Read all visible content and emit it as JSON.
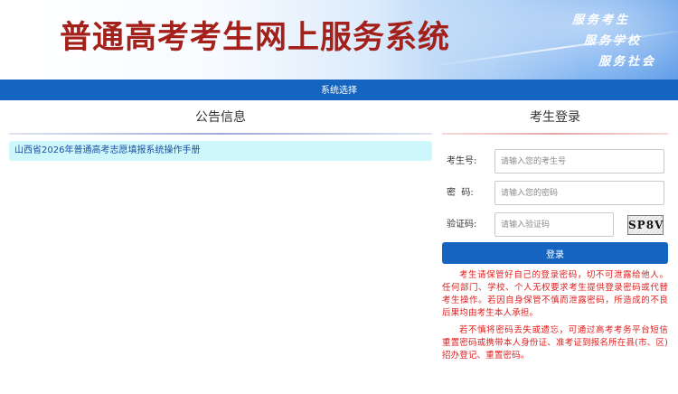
{
  "header": {
    "title": "普通高考考生网上服务系统",
    "slogans": [
      "服务考生",
      "服务学校",
      "服务社会"
    ]
  },
  "nav": {
    "items": [
      {
        "label": "系统选择"
      }
    ]
  },
  "notice": {
    "title": "公告信息",
    "items": [
      {
        "text": "山西省2026年普通高考志愿填报系统操作手册"
      }
    ]
  },
  "login": {
    "title": "考生登录",
    "fields": {
      "exam_no": {
        "label": "考生号:",
        "placeholder": "请输入您的考生号",
        "value": ""
      },
      "password": {
        "label": "密  码:",
        "placeholder": "请输入您的密码",
        "value": ""
      },
      "captcha": {
        "label": "验证码:",
        "placeholder": "请输入验证码",
        "value": "",
        "image_text": "SP8V"
      }
    },
    "button_label": "登录",
    "warnings": [
      "考生请保管好自己的登录密码，切不可泄露给他人。任何部门、学校、个人无权要求考生提供登录密码或代替考生操作。若因自身保管不慎而泄露密码，所造成的不良后果均由考生本人承担。",
      "若不慎将密码丢失或遗忘，可通过高考考务平台短信重置密码或携带本人身份证、准考证到报名所在县(市、区)招办登记、重置密码。"
    ]
  },
  "colors": {
    "title_red": "#a4201b",
    "primary_blue": "#1565c0",
    "notice_bg": "#cdf7fa",
    "warning_red": "#e01e1e"
  }
}
